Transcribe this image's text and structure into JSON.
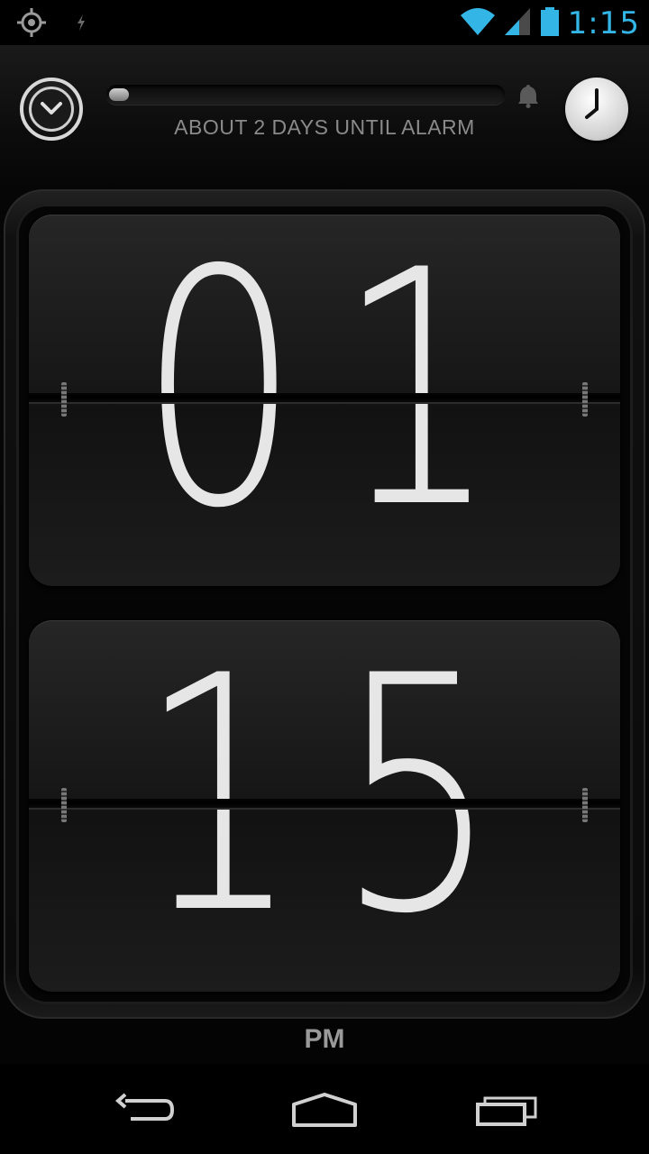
{
  "status_bar": {
    "time": "1:15",
    "icons": [
      "gps-icon",
      "bluetooth-icon",
      "wifi-icon",
      "signal-icon",
      "battery-icon"
    ],
    "time_color": "#33b5e5"
  },
  "alarm": {
    "status_text": "ABOUT 2 DAYS UNTIL ALARM",
    "progress_percent": 5
  },
  "clock": {
    "hour_digits": [
      "0",
      "1"
    ],
    "minute_digits": [
      "1",
      "5"
    ],
    "ampm": "PM"
  },
  "nav": {
    "buttons": [
      "back-icon",
      "home-icon",
      "recent-apps-icon"
    ]
  }
}
